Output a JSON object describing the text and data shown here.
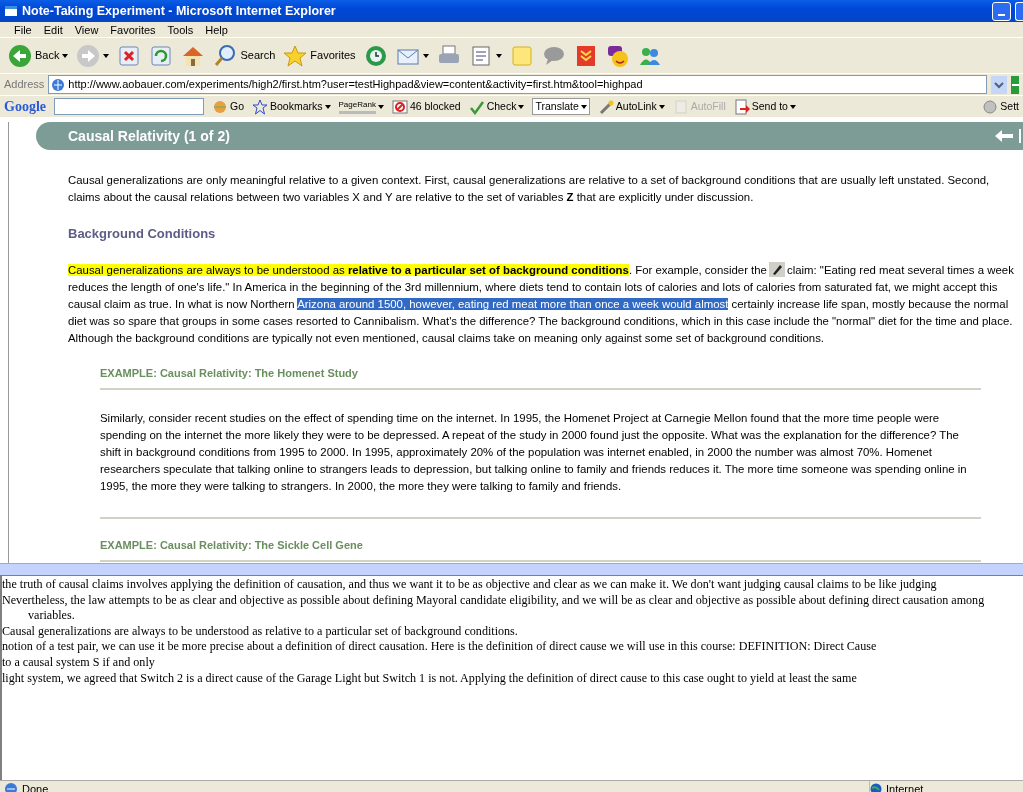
{
  "window": {
    "title": "Note-Taking Experiment - Microsoft Internet Explorer"
  },
  "menu": [
    "File",
    "Edit",
    "View",
    "Favorites",
    "Tools",
    "Help"
  ],
  "toolbar": [
    {
      "kind": "back",
      "label": "Back",
      "dropdown": true
    },
    {
      "kind": "forward",
      "dropdown": true
    },
    {
      "kind": "stop",
      "dropdown": false
    },
    {
      "kind": "refresh",
      "dropdown": false
    },
    {
      "kind": "home",
      "dropdown": false
    },
    {
      "kind": "search",
      "label": "Search",
      "dropdown": false
    },
    {
      "kind": "favorites",
      "label": "Favorites",
      "dropdown": false
    },
    {
      "kind": "history",
      "dropdown": false
    },
    {
      "kind": "mail",
      "dropdown": true
    },
    {
      "kind": "print",
      "dropdown": false
    },
    {
      "kind": "word",
      "dropdown": true
    },
    {
      "kind": "note",
      "dropdown": false
    },
    {
      "kind": "discuss",
      "dropdown": false
    },
    {
      "kind": "download",
      "dropdown": false
    },
    {
      "kind": "yahoo",
      "dropdown": false
    },
    {
      "kind": "people",
      "dropdown": false
    }
  ],
  "address": {
    "label": "Address",
    "url": "http://www.aobauer.com/experiments/high2/first.htm?user=testHighpad&view=content&activity=first.htm&tool=highpad"
  },
  "google_bar": {
    "logo": "Google",
    "items": [
      {
        "kind": "go",
        "label": "Go",
        "disabled": false,
        "dropdown": false
      },
      {
        "kind": "bookmarks",
        "label": "Bookmarks",
        "disabled": false,
        "dropdown": true
      },
      {
        "kind": "pagerank",
        "label": "PageRank",
        "disabled": false,
        "dropdown": true
      },
      {
        "kind": "blocked",
        "label": "46 blocked",
        "disabled": false,
        "dropdown": false
      },
      {
        "kind": "check",
        "label": "Check",
        "disabled": false,
        "dropdown": true
      },
      {
        "kind": "translate",
        "label": "Translate",
        "disabled": false,
        "dropdown": true
      },
      {
        "kind": "autolink",
        "label": "AutoLink",
        "disabled": false,
        "dropdown": true
      },
      {
        "kind": "autofill",
        "label": "AutoFill",
        "disabled": true,
        "dropdown": false
      },
      {
        "kind": "sendto",
        "label": "Send to",
        "disabled": false,
        "dropdown": true
      },
      {
        "kind": "settings",
        "label": "Sett",
        "disabled": false,
        "dropdown": false
      }
    ]
  },
  "page": {
    "header": "Causal Relativity (1 of 2)",
    "intro": "Causal generalizations are only meaningful relative to a given context. First, causal generalizations are relative to a set of background conditions that are usually left unstated. Second, claims about the causal relations between two variables X and Y are relative to the set of variables **Z** that are explicitly under discussion.",
    "section_heading": "Background Conditions",
    "paragraph": [
      {
        "text": "Causal generalizations are always to be understood as **relative to a particular set of background conditions**",
        "kind": "highlight"
      },
      {
        "text": ". For example, consider the",
        "kind": "plain"
      },
      {
        "kind": "pencil"
      },
      {
        "text": "claim: \"Eating red meat several times a week reduces the length of one's life.\" In America in the beginning of the 3rd millennium, where diets tend to contain lots of calories and lots of calories from saturated fat, we might accept this causal claim as true. In what is now Northern ",
        "kind": "plain"
      },
      {
        "text": "Arizona around 1500, however, eating red meat more than once a week would almost",
        "kind": "selection"
      },
      {
        "text": " certainly increase life span, mostly because the normal diet was so spare that groups in some cases resorted to Cannibalism. What's the difference? The background conditions, which in this case include the \"normal\" diet for the time and place. Although the background conditions are typically not even mentioned, causal claims take on meaning only against some set of background conditions.",
        "kind": "plain"
      }
    ],
    "examples": [
      {
        "title": "EXAMPLE: Causal Relativity: The Homenet Study",
        "body": "Similarly, consider recent studies on the effect of spending time on the internet. In 1995, the Homenet Project at Carnegie Mellon found that the more time people were spending on the internet the more likely they were to be depressed. A repeat of the study in 2000 found just the opposite. What was the explanation for the difference? The shift in background conditions from 1995 to 2000. In 1995, approximately 20% of the population was internet enabled, in 2000 the number was almost 70%. Homenet researchers speculate that talking online to strangers leads to depression, but talking online to family and friends reduces it. The more time someone was spending online in 1995, the more they were talking to strangers. In 2000, the more they were talking to family and friends."
      },
      {
        "title": "EXAMPLE: Causal Relativity: The Sickle Cell Gene"
      }
    ]
  },
  "notes": [
    "the truth of causal claims involves applying the definition of causation, and thus we want it to be as objective and clear as we can make it. We don't want judging causal claims to be like judging",
    "Nevertheless, the law attempts to be as clear and objective as possible about defining Mayoral candidate eligibility, and we will be as clear and objective as possible about defining direct causation among variables.",
    "Causal generalizations are always to be understood as relative to a particular set of background conditions.",
    "notion of a test pair, we can use it be more precise about a definition of direct causation. Here is the definition of direct cause we will use in this course: DEFINITION: Direct Cause",
    "to a causal system S if and only",
    "light system, we agreed that Switch 2 is a direct cause of the Garage Light but Switch 1 is not. Applying the definition of direct cause to this case ought to yield at least the same"
  ],
  "status_bar": {
    "text": "Done",
    "zone": "Internet"
  }
}
